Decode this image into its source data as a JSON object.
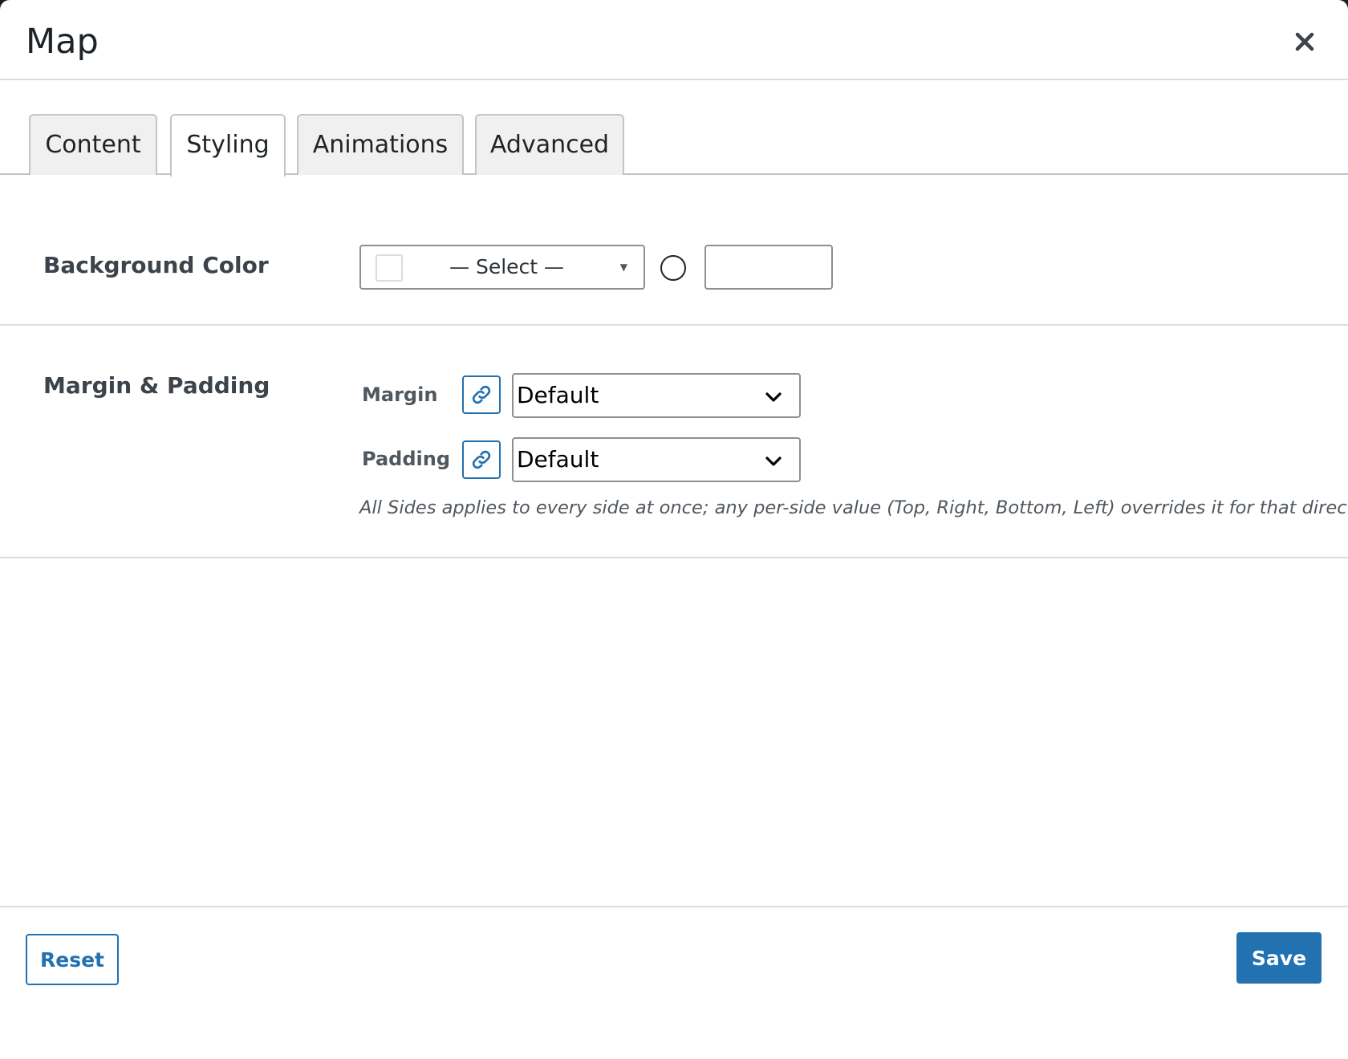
{
  "modal": {
    "title": "Map",
    "close_icon": "close-icon"
  },
  "tabs": [
    {
      "label": "Content",
      "active": false
    },
    {
      "label": "Styling",
      "active": true
    },
    {
      "label": "Animations",
      "active": false
    },
    {
      "label": "Advanced",
      "active": false
    }
  ],
  "background_color": {
    "label": "Background Color",
    "select_placeholder": "— Select —",
    "swatch_color": "#ffffff",
    "custom_value": ""
  },
  "spacing": {
    "label": "Margin & Padding",
    "margin": {
      "label": "Margin",
      "value": "Default",
      "link_icon": "link-icon"
    },
    "padding": {
      "label": "Padding",
      "value": "Default",
      "link_icon": "link-icon"
    },
    "help": "All Sides applies to every side at once; any per-side value (Top, Right, Bottom, Left) overrides it for that direction."
  },
  "footer": {
    "reset_label": "Reset",
    "save_label": "Save"
  },
  "colors": {
    "accent": "#2271b1",
    "border": "#dcdcde",
    "tab_inactive": "#f0f0f1"
  }
}
